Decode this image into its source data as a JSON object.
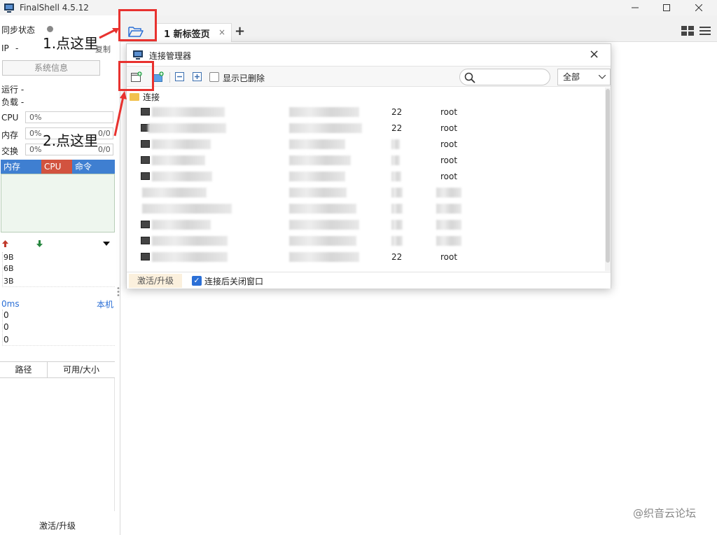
{
  "window": {
    "title": "FinalShell 4.5.12",
    "controls": [
      "minimize-icon",
      "maximize-icon",
      "close-icon"
    ]
  },
  "sidebar": {
    "sync_label": "同步状态",
    "ip_label": "IP",
    "ip_value": "-",
    "copy_label": "复制",
    "sysinfo_button": "系统信息",
    "run_label": "运行 -",
    "load_label": "负载 -",
    "cpu_label": "CPU",
    "cpu_value": "0%",
    "mem_label": "内存",
    "mem_value": "0%",
    "mem_side": "0/0",
    "swap_label": "交换",
    "swap_value": "0%",
    "swap_side": "0/0",
    "proc_tabs": [
      "内存",
      "CPU",
      "命令"
    ],
    "net_scale": [
      "9B",
      "6B",
      "3B"
    ],
    "latency_label": "0ms",
    "latency_target": "本机",
    "latency_values": [
      "0",
      "0",
      "0"
    ],
    "disk_columns": [
      "路径",
      "可用/大小"
    ],
    "footer": "激活/升级"
  },
  "tabs": {
    "items": [
      {
        "label": "1 新标签页"
      }
    ],
    "close_glyph": "×",
    "add_glyph": "+"
  },
  "dialog": {
    "title": "连接管理器",
    "close_glyph": "×",
    "show_deleted_label": "显示已删除",
    "show_deleted_checked": false,
    "search_placeholder": "",
    "filter_value": "全部",
    "group_name": "连接",
    "rows": [
      {
        "port": "22",
        "user": "root"
      },
      {
        "port": "22",
        "user": "root"
      },
      {
        "port": "",
        "user": "root"
      },
      {
        "port": "",
        "user": "root"
      },
      {
        "port": "",
        "user": "root"
      },
      {
        "port": "",
        "user": ""
      },
      {
        "port": "",
        "user": ""
      },
      {
        "port": "",
        "user": ""
      },
      {
        "port": "",
        "user": ""
      },
      {
        "port": "22",
        "user": "root"
      }
    ],
    "footer_activate": "激活/升级",
    "close_after_connect_label": "连接后关闭窗口",
    "close_after_connect_checked": true
  },
  "annotations": {
    "step1": "1.点这里",
    "step2": "2.点这里"
  },
  "watermark": "@织音云论坛",
  "colors": {
    "highlight_red": "#e8322f",
    "proc_tab_mem": "#3f7fd1",
    "proc_tab_cpu": "#d2533f",
    "proc_tab_cmd": "#3f7fd1",
    "activate_bg": "#fbf0dd"
  }
}
